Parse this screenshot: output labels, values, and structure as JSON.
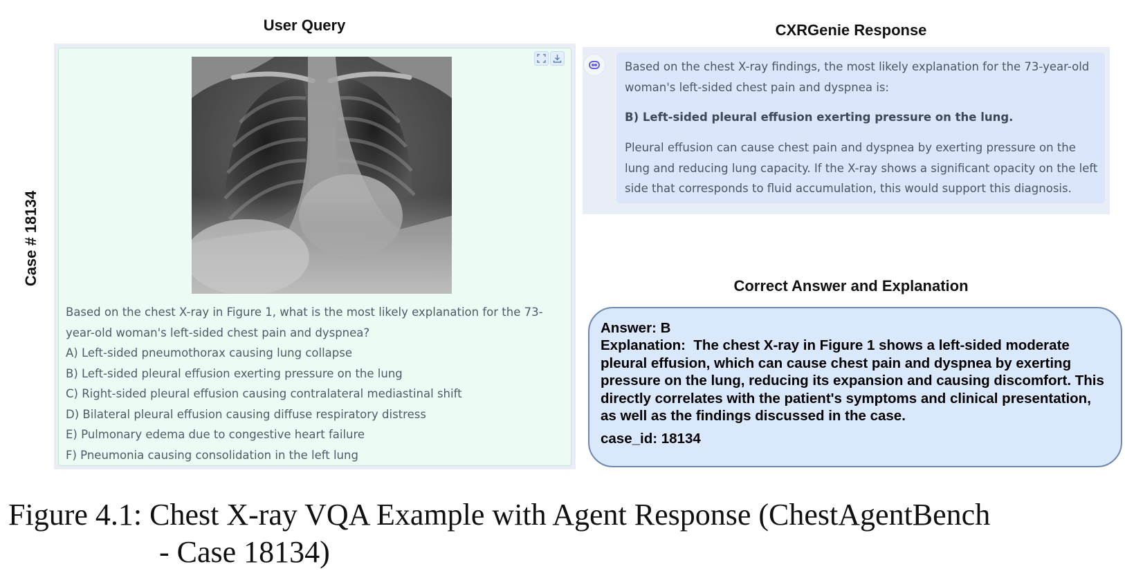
{
  "headings": {
    "user_query": "User Query",
    "response": "CXRGenie Response",
    "correct": "Correct Answer and Explanation"
  },
  "case_label": "Case # 18134",
  "query": {
    "question": "Based on the chest X-ray in Figure 1, what is the most likely explanation for the 73-year-old woman's left-sided chest pain and dyspnea?",
    "options": [
      "A) Left-sided pneumothorax causing lung collapse",
      "B) Left-sided pleural effusion exerting pressure on the lung",
      "C) Right-sided pleural effusion causing contralateral mediastinal shift",
      "D) Bilateral pleural effusion causing diffuse respiratory distress",
      "E) Pulmonary edema due to congestive heart failure",
      "F) Pneumonia causing consolidation in the left lung"
    ],
    "toolbar_icons": [
      "fullscreen-icon",
      "download-icon"
    ]
  },
  "response": {
    "p1": "Based on the chest X-ray findings, the most likely explanation for the 73-year-old woman's left-sided chest pain and dyspnea is:",
    "p2": "B) Left-sided pleural effusion exerting pressure on the lung.",
    "p3": "Pleural effusion can cause chest pain and dyspnea by exerting pressure on the lung and reducing lung capacity. If the X-ray shows a significant opacity on the left side that corresponds to fluid accumulation, this would support this diagnosis.",
    "avatar_icon": "bot-icon"
  },
  "correct": {
    "answer": "Answer: B",
    "explanation": "Explanation:  The chest X-ray in Figure 1 shows a left-sided moderate pleural effusion, which can cause chest pain and dyspnea by exerting pressure on the lung, reducing its expansion and causing discomfort. This directly correlates with the patient's symptoms and clinical presentation, as well as the findings discussed in the case.",
    "case_id": "case_id: 18134"
  },
  "caption": {
    "line1": "Figure 4.1: Chest X-ray VQA Example with Agent Response (ChestAgentBench",
    "line2": "- Case 18134)"
  },
  "colors": {
    "query_panel": "#ecfbf4",
    "response_bubble": "#dbe6fa",
    "answer_box": "#dae8fb",
    "answer_border": "#6e86b2"
  }
}
